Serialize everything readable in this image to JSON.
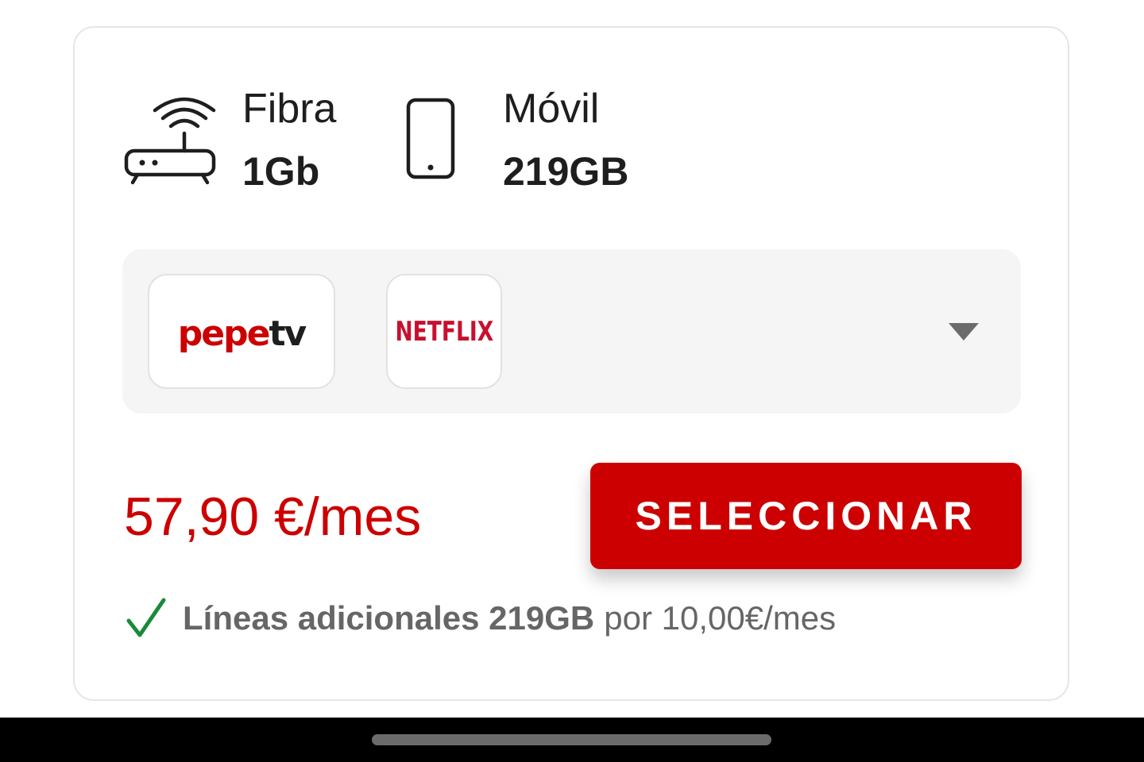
{
  "plan": {
    "fibra": {
      "label": "Fibra",
      "value": "1Gb",
      "icon": "router-wifi-icon"
    },
    "movil": {
      "label": "Móvil",
      "value": "219GB",
      "icon": "smartphone-icon"
    }
  },
  "services": {
    "pepetv": {
      "logo_text_red": "pepe",
      "logo_text_dark": "tv"
    },
    "netflix": {
      "logo_text": "NETFLIX"
    },
    "expand_icon": "chevron-down-icon"
  },
  "price": "57,90 €/mes",
  "select_button": "SELECCIONAR",
  "extra_lines": {
    "bold_text": "Líneas adicionales 219GB",
    "rest_text": "por 10,00€/mes",
    "icon": "check-icon"
  },
  "colors": {
    "brand_red": "#cc0000",
    "netflix_red": "#c8102e",
    "check_green": "#1a8a3a",
    "muted_text": "#666666"
  }
}
